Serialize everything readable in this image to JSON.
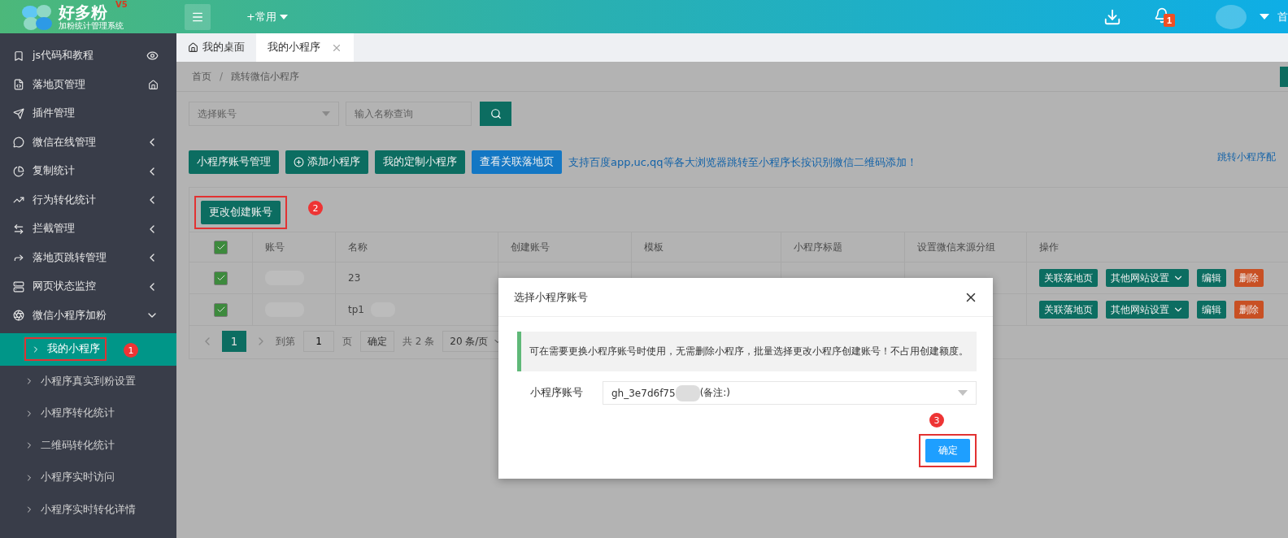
{
  "header": {
    "logo": {
      "name": "好多粉",
      "version": "V5",
      "subtitle": "加粉统计管理系统"
    },
    "quick_menu": "+常用",
    "notification_count": "1",
    "cut_link": "首"
  },
  "sidebar": {
    "items": [
      {
        "label": "js代码和教程"
      },
      {
        "label": "落地页管理"
      },
      {
        "label": "插件管理"
      },
      {
        "label": "微信在线管理",
        "expanded": false
      },
      {
        "label": "复制统计",
        "expanded": false
      },
      {
        "label": "行为转化统计",
        "expanded": false
      },
      {
        "label": "拦截管理",
        "expanded": false
      },
      {
        "label": "落地页跳转管理",
        "expanded": false
      },
      {
        "label": "网页状态监控",
        "expanded": false
      },
      {
        "label": "微信小程序加粉",
        "expanded": true,
        "children": [
          {
            "label": "我的小程序",
            "selected": true,
            "annotation": "1"
          },
          {
            "label": "小程序真实到粉设置",
            "selected": false
          },
          {
            "label": "小程序转化统计",
            "selected": false
          },
          {
            "label": "二维码转化统计",
            "selected": false
          },
          {
            "label": "小程序实时访问",
            "selected": false
          },
          {
            "label": "小程序实时转化详情",
            "selected": false
          }
        ]
      }
    ]
  },
  "tabs": [
    {
      "label": "我的桌面",
      "selected": false
    },
    {
      "label": "我的小程序",
      "selected": true
    }
  ],
  "breadcrumb": {
    "items": [
      "首页",
      "跳转微信小程序"
    ],
    "separator": "/"
  },
  "filters": {
    "account_select": {
      "placeholder": "选择账号"
    },
    "name_search": {
      "placeholder": "输入名称查询"
    }
  },
  "toolbar": {
    "buttons": [
      {
        "label": "小程序账号管理",
        "kind": "primary"
      },
      {
        "label": "添加小程序",
        "kind": "add"
      },
      {
        "label": "我的定制小程序",
        "kind": "primary"
      },
      {
        "label": "查看关联落地页",
        "kind": "blue"
      }
    ],
    "notice_link": "支持百度app,uc,qq等各大浏览器跳转至小程序长按识别微信二维码添加！",
    "right_link": "跳转小程序配"
  },
  "batch_button": {
    "label": "更改创建账号",
    "annotation": "2"
  },
  "table": {
    "header_checked": true,
    "columns": [
      "账号",
      "名称",
      "创建账号",
      "模板",
      "小程序标题",
      "设置微信来源分组",
      "操作"
    ],
    "rows": [
      {
        "checked": true,
        "name": "23",
        "actions": [
          "关联落地页",
          "其他网站设置",
          "编辑",
          "删除"
        ]
      },
      {
        "checked": true,
        "name": "tp1",
        "actions": [
          "关联落地页",
          "其他网站设置",
          "编辑",
          "删除"
        ]
      }
    ]
  },
  "pagination": {
    "pages": [
      {
        "label": "1",
        "selected": true
      }
    ],
    "goto_label": "到第",
    "goto_value": "1",
    "page_unit": "页",
    "confirm": "确定",
    "total": "共 2 条",
    "page_size": "20 条/页"
  },
  "modal": {
    "title": "选择小程序账号",
    "notice": "可在需要更换小程序账号时使用，无需删除小程序，批量选择更改小程序创建账号！不占用创建额度。",
    "field_label": "小程序账号",
    "field_value": "gh_3e7d6f75",
    "field_note": "(备注:)",
    "confirm": "确定",
    "annotation": "3"
  }
}
